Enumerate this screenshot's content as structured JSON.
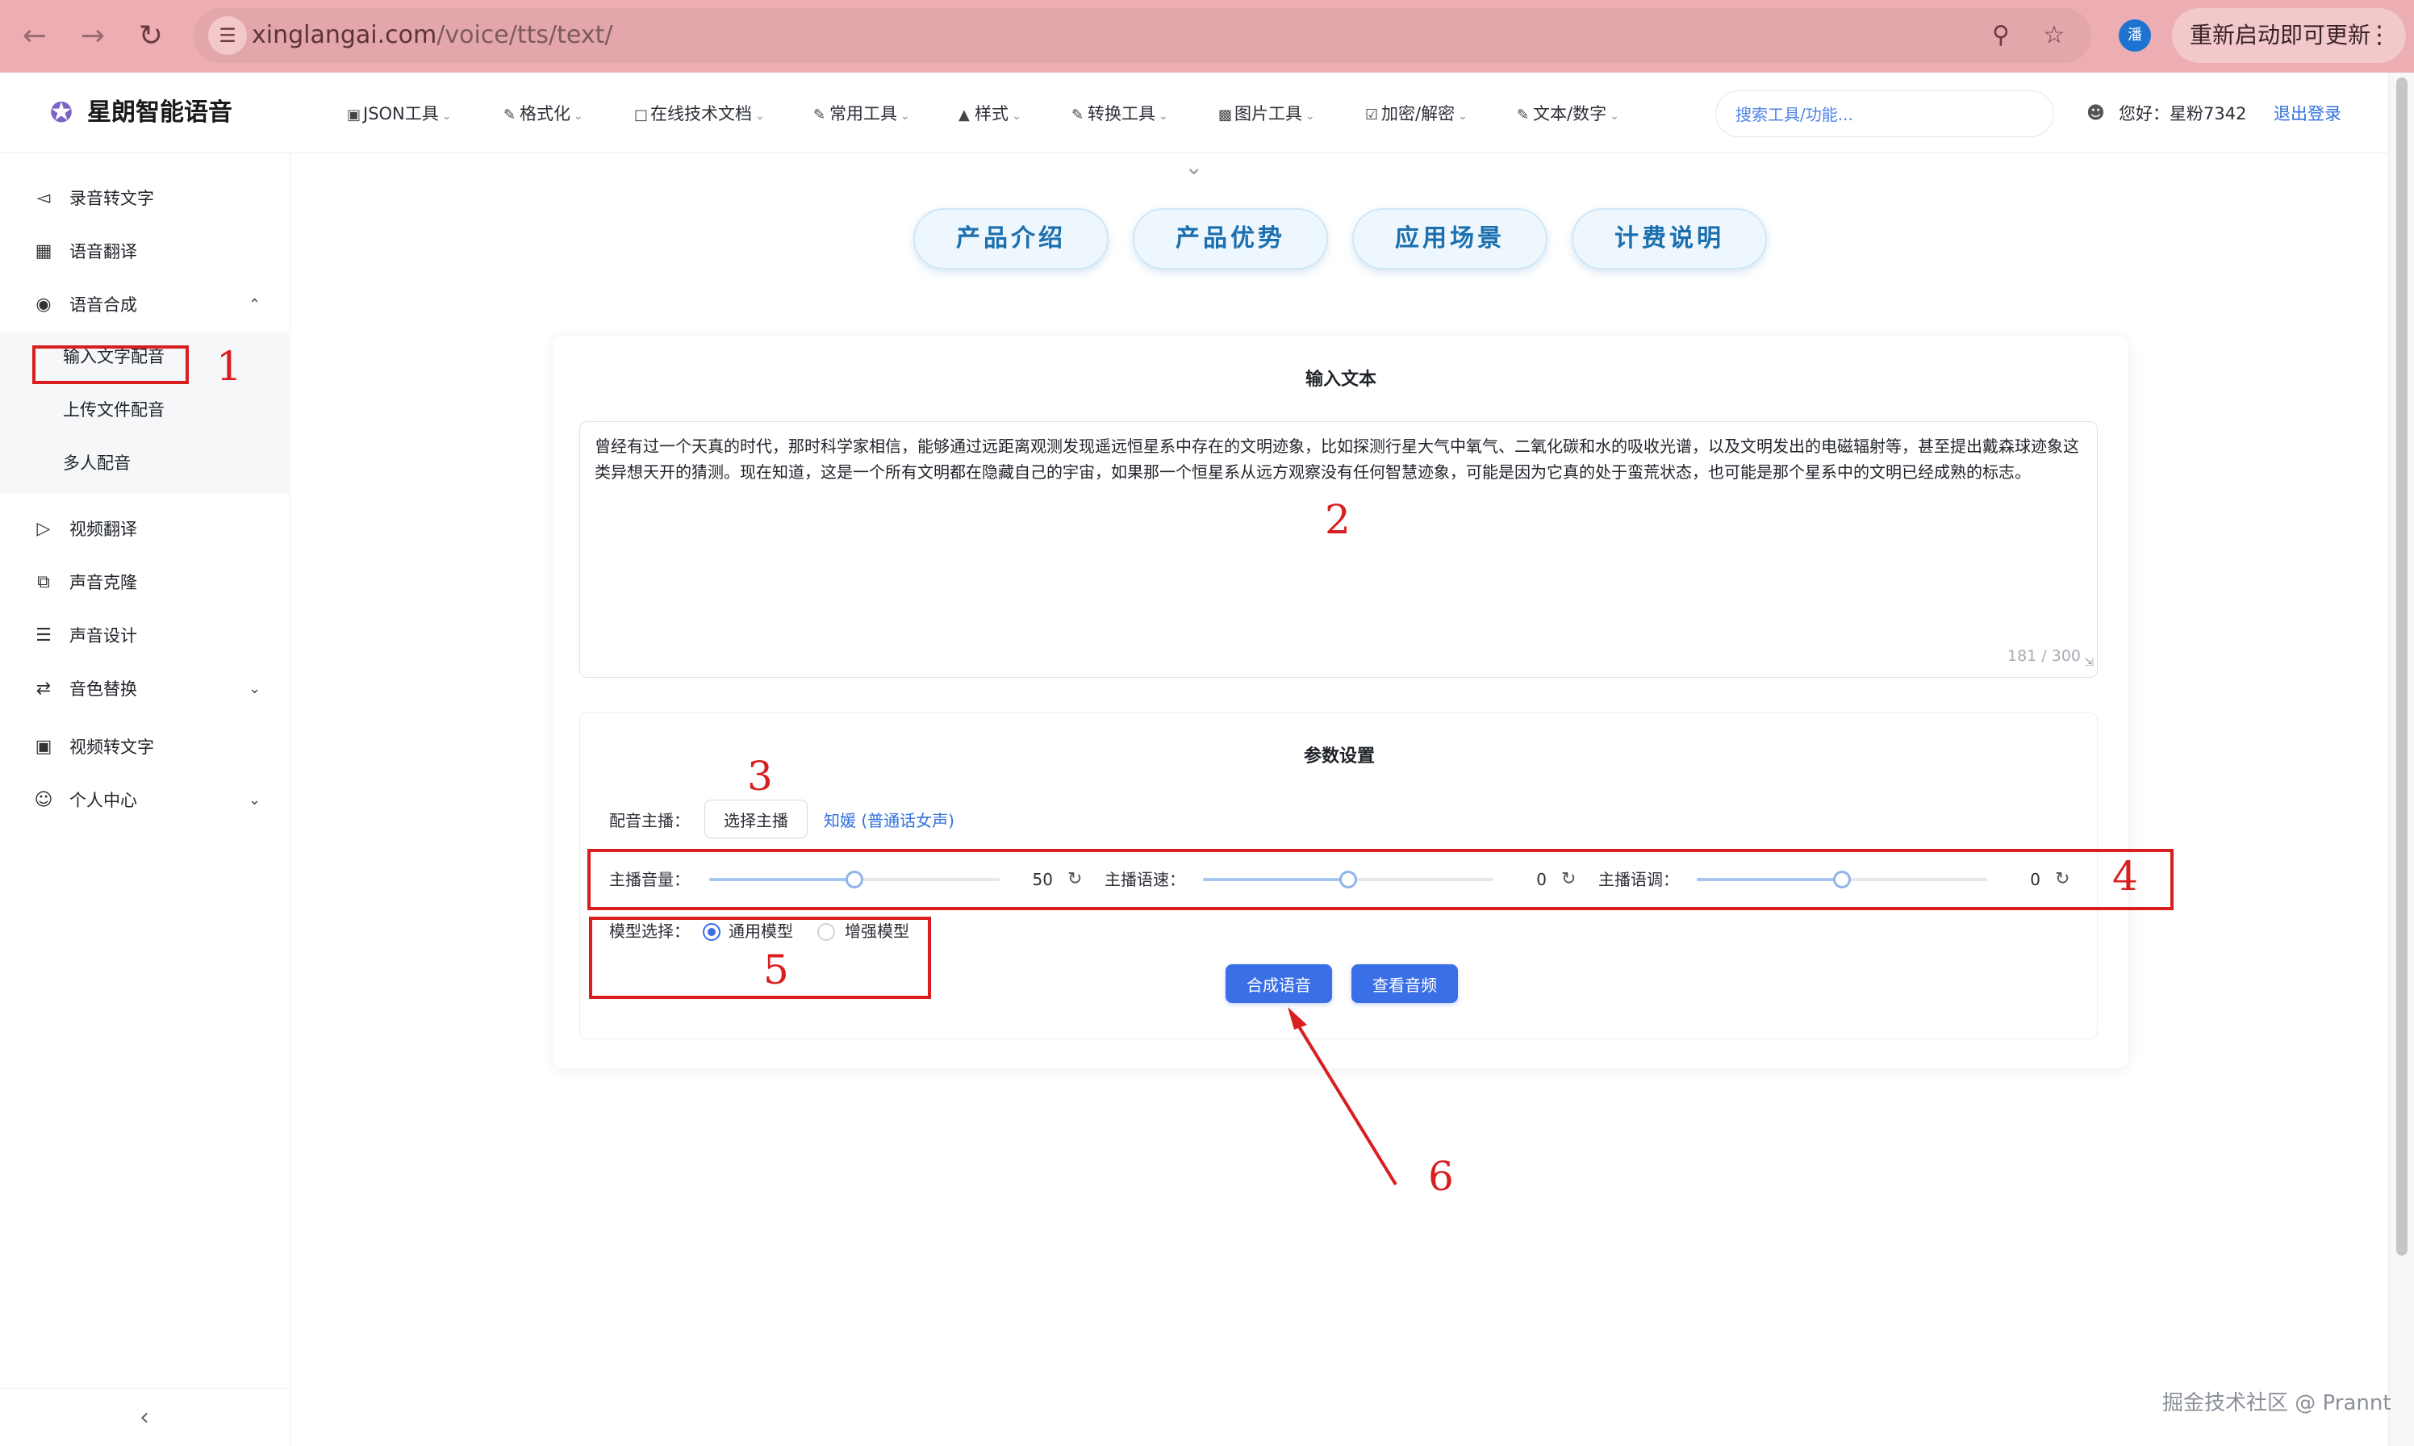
{
  "browser": {
    "url_host": "xinglangai.com",
    "url_path": "/voice/tts/text/",
    "profile_initial": "潘",
    "restart_label": "重新启动即可更新",
    "icons": [
      "back-arrow-icon",
      "forward-arrow-icon",
      "reload-icon",
      "site-settings-icon",
      "zoom-icon",
      "star-icon",
      "kebab-menu-icon"
    ]
  },
  "header": {
    "logo_text": "星朗智能语音",
    "menu": [
      {
        "label": "JSON工具",
        "icon": "terminal-icon"
      },
      {
        "label": "格式化",
        "icon": "edit-icon"
      },
      {
        "label": "在线技术文档",
        "icon": "document-icon"
      },
      {
        "label": "常用工具",
        "icon": "edit-icon"
      },
      {
        "label": "样式",
        "icon": "paint-icon"
      },
      {
        "label": "转换工具",
        "icon": "edit-icon"
      },
      {
        "label": "图片工具",
        "icon": "image-icon"
      },
      {
        "label": "加密/解密",
        "icon": "lock-icon"
      },
      {
        "label": "文本/数字",
        "icon": "edit-icon"
      }
    ],
    "search_placeholder": "搜索工具/功能...",
    "greeting": "您好：星粉7342",
    "logout": "退出登录"
  },
  "sidebar": {
    "items": [
      {
        "label": "录音转文字",
        "icon": "speaker-icon"
      },
      {
        "label": "语音翻译",
        "icon": "translate-icon"
      },
      {
        "label": "语音合成",
        "icon": "microphone-icon"
      }
    ],
    "sub_items": [
      {
        "label": "输入文字配音",
        "active": true
      },
      {
        "label": "上传文件配音"
      },
      {
        "label": "多人配音"
      }
    ],
    "items_after": [
      {
        "label": "视频翻译",
        "icon": "play-square-icon"
      },
      {
        "label": "声音克隆",
        "icon": "copy-icon"
      },
      {
        "label": "声音设计",
        "icon": "equalizer-icon"
      },
      {
        "label": "音色替换",
        "icon": "swap-icon"
      },
      {
        "label": "视频转文字",
        "icon": "video-icon"
      },
      {
        "label": "个人中心",
        "icon": "user-icon"
      }
    ]
  },
  "tabs": [
    "产品介绍",
    "产品优势",
    "应用场景",
    "计费说明"
  ],
  "input": {
    "title": "输入文本",
    "text": "曾经有过一个天真的时代，那时科学家相信，能够通过远距离观测发现遥远恒星系中存在的文明迹象，比如探测行星大气中氧气、二氧化碳和水的吸收光谱，以及文明发出的电磁辐射等，甚至提出戴森球迹象这类异想天开的猜测。现在知道，这是一个所有文明都在隐藏自己的宇宙，如果那一个恒星系从远方观察没有任何智慧迹象，可能是因为它真的处于蛮荒状态，也可能是那个星系中的文明已经成熟的标志。",
    "count": "181 / 300"
  },
  "params": {
    "title": "参数设置",
    "voice_label": "配音主播：",
    "choose_voice": "选择主播",
    "voice_name": "知媛 (普通话女声)",
    "sliders": [
      {
        "label": "主播音量：",
        "value": "50",
        "fraction": 0.5
      },
      {
        "label": "主播语速：",
        "value": "0",
        "fraction": 0.5
      },
      {
        "label": "主播语调：",
        "value": "0",
        "fraction": 0.5
      }
    ],
    "model_label": "模型选择：",
    "models": [
      {
        "label": "通用模型",
        "checked": true
      },
      {
        "label": "增强模型",
        "checked": false
      }
    ],
    "synthesize": "合成语音",
    "view_audio": "查看音频"
  },
  "annotations": [
    "1",
    "2",
    "3",
    "4",
    "5",
    "6"
  ],
  "annotation_color": "#d81e1e",
  "accent_color": "#3b6fe6",
  "watermark": "掘金技术社区 @ Prannt"
}
